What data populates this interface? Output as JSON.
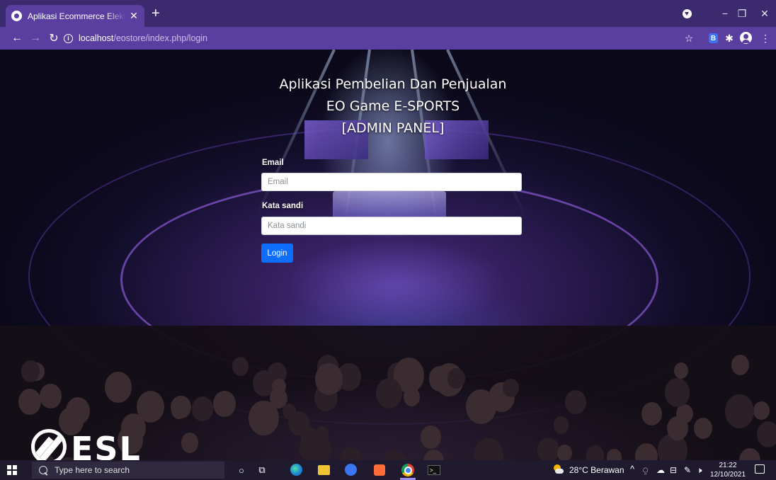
{
  "browser": {
    "tab_title": "Aplikasi Ecommerce Elektronik R",
    "tab_close": "✕",
    "new_tab": "+",
    "url_host": "localhost",
    "url_path": "/eostore/index.php/login",
    "window_minimize": "−",
    "window_restore": "❐",
    "window_close": "✕"
  },
  "page": {
    "title_lines": [
      "Aplikasi Pembelian Dan Penjualan",
      "EO Game E-SPORTS",
      "[ADMIN PANEL]"
    ],
    "email_label": "Email",
    "email_placeholder": "Email",
    "password_label": "Kata sandi",
    "password_placeholder": "Kata sandi",
    "login_button": "Login",
    "background_logo_text": "ESL"
  },
  "taskbar": {
    "search_placeholder": "Type here to search",
    "weather": "28°C  Berawan",
    "time": "21:22",
    "date": "12/10/2021",
    "tray_icons": [
      "chevron-up-icon",
      "onedrive-icon",
      "cloud-icon",
      "network-icon",
      "pen-icon",
      "volume-icon"
    ],
    "pinned": [
      "cortana-icon",
      "task-view-icon",
      "edge-icon",
      "file-explorer-icon",
      "signal-icon",
      "postman-icon",
      "chrome-icon",
      "terminal-icon"
    ]
  },
  "colors": {
    "browser_frame": "#3b2a6e",
    "browser_toolbar": "#5a3fa0",
    "login_button": "#0d6efd",
    "taskbar": "#1f1a2e"
  }
}
